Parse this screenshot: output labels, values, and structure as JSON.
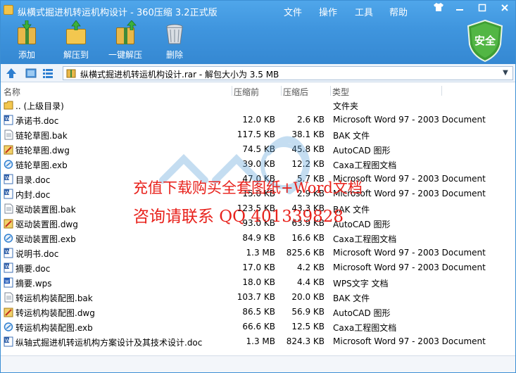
{
  "window": {
    "title": "纵横式掘进机转运机构设计 - 360压缩 3.2正式版"
  },
  "menu": {
    "file": "文件",
    "operation": "操作",
    "tools": "工具",
    "help": "帮助"
  },
  "toolbar": {
    "add": "添加",
    "extract_to": "解压到",
    "one_click": "一键解压",
    "delete": "删除"
  },
  "security_badge": "安全",
  "address": {
    "text": "纵横式掘进机转运机构设计.rar - 解包大小为 3.5 MB"
  },
  "columns": {
    "name": "名称",
    "size": "压缩前",
    "packed": "压缩后",
    "type": "类型"
  },
  "files": [
    {
      "icon": "folder-up-icon",
      "name": ".. (上级目录)",
      "size": "",
      "packed": "",
      "type": "文件夹"
    },
    {
      "icon": "word-doc-icon",
      "name": "承诺书.doc",
      "size": "12.0 KB",
      "packed": "2.6 KB",
      "type": "Microsoft Word 97 - 2003 Document"
    },
    {
      "icon": "bak-file-icon",
      "name": "链轮草图.bak",
      "size": "117.5 KB",
      "packed": "38.1 KB",
      "type": "BAK 文件"
    },
    {
      "icon": "dwg-file-icon",
      "name": "链轮草图.dwg",
      "size": "74.5 KB",
      "packed": "45.8 KB",
      "type": "AutoCAD 图形"
    },
    {
      "icon": "exb-file-icon",
      "name": "链轮草图.exb",
      "size": "39.0 KB",
      "packed": "12.2 KB",
      "type": "Caxa工程图文档"
    },
    {
      "icon": "word-doc-icon",
      "name": "目录.doc",
      "size": "47.0 KB",
      "packed": "5.7 KB",
      "type": "Microsoft Word 97 - 2003 Document"
    },
    {
      "icon": "word-doc-icon",
      "name": "内封.doc",
      "size": "15.0 KB",
      "packed": "2.9 KB",
      "type": "Microsoft Word 97 - 2003 Document"
    },
    {
      "icon": "bak-file-icon",
      "name": "驱动装置图.bak",
      "size": "123.5 KB",
      "packed": "43.3 KB",
      "type": "BAK 文件"
    },
    {
      "icon": "dwg-file-icon",
      "name": "驱动装置图.dwg",
      "size": "93.0 KB",
      "packed": "63.9 KB",
      "type": "AutoCAD 图形"
    },
    {
      "icon": "exb-file-icon",
      "name": "驱动装置图.exb",
      "size": "84.9 KB",
      "packed": "16.6 KB",
      "type": "Caxa工程图文档"
    },
    {
      "icon": "word-doc-icon",
      "name": "说明书.doc",
      "size": "1.3 MB",
      "packed": "825.6 KB",
      "type": "Microsoft Word 97 - 2003 Document"
    },
    {
      "icon": "word-doc-icon",
      "name": "摘要.doc",
      "size": "17.0 KB",
      "packed": "4.2 KB",
      "type": "Microsoft Word 97 - 2003 Document"
    },
    {
      "icon": "wps-file-icon",
      "name": "摘要.wps",
      "size": "18.0 KB",
      "packed": "4.4 KB",
      "type": "WPS文字 文档"
    },
    {
      "icon": "bak-file-icon",
      "name": "转运机构装配图.bak",
      "size": "103.7 KB",
      "packed": "20.0 KB",
      "type": "BAK 文件"
    },
    {
      "icon": "dwg-file-icon",
      "name": "转运机构装配图.dwg",
      "size": "86.5 KB",
      "packed": "56.9 KB",
      "type": "AutoCAD 图形"
    },
    {
      "icon": "exb-file-icon",
      "name": "转运机构装配图.exb",
      "size": "66.6 KB",
      "packed": "12.5 KB",
      "type": "Caxa工程图文档"
    },
    {
      "icon": "word-doc-icon",
      "name": "纵轴式掘进机转运机构方案设计及其技术设计.doc",
      "size": "1.3 MB",
      "packed": "824.3 KB",
      "type": "Microsoft Word 97 - 2003 Document"
    }
  ],
  "watermark": {
    "line1": "充值下载购买全套图纸+Word文档",
    "line2": "咨询请联系 QQ 401339828"
  }
}
